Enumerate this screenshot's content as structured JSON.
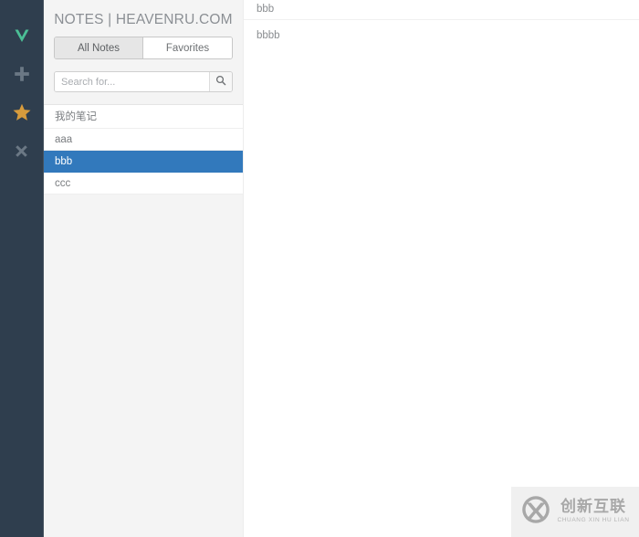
{
  "colors": {
    "rail_bg": "#2f3e4e",
    "accent_selected": "#3279bc",
    "star": "#d79b3c",
    "check": "#4bbf96",
    "panel_bg": "#f4f4f4",
    "text_muted": "#8b8f94"
  },
  "rail": {
    "items": [
      {
        "name": "check-icon",
        "label": "Save note"
      },
      {
        "name": "plus-icon",
        "label": "New note"
      },
      {
        "name": "star-icon",
        "label": "Favorite"
      },
      {
        "name": "close-icon",
        "label": "Delete note"
      }
    ]
  },
  "list_panel": {
    "title": "NOTES | HEAVENRU.COM",
    "tabs": [
      {
        "label": "All Notes",
        "active": true
      },
      {
        "label": "Favorites",
        "active": false
      }
    ],
    "search": {
      "value": "",
      "placeholder": "Search for...",
      "button_icon": "search-icon"
    },
    "notes": [
      {
        "title": "我的笔记",
        "selected": false
      },
      {
        "title": "aaa",
        "selected": false
      },
      {
        "title": "bbb",
        "selected": true
      },
      {
        "title": "ccc",
        "selected": false
      }
    ]
  },
  "editor": {
    "title": "bbb",
    "body": "bbbb"
  },
  "watermark": {
    "logo": "cx-circle-logo",
    "cn": "创新互联",
    "pinyin": "CHUANG XIN HU LIAN"
  }
}
